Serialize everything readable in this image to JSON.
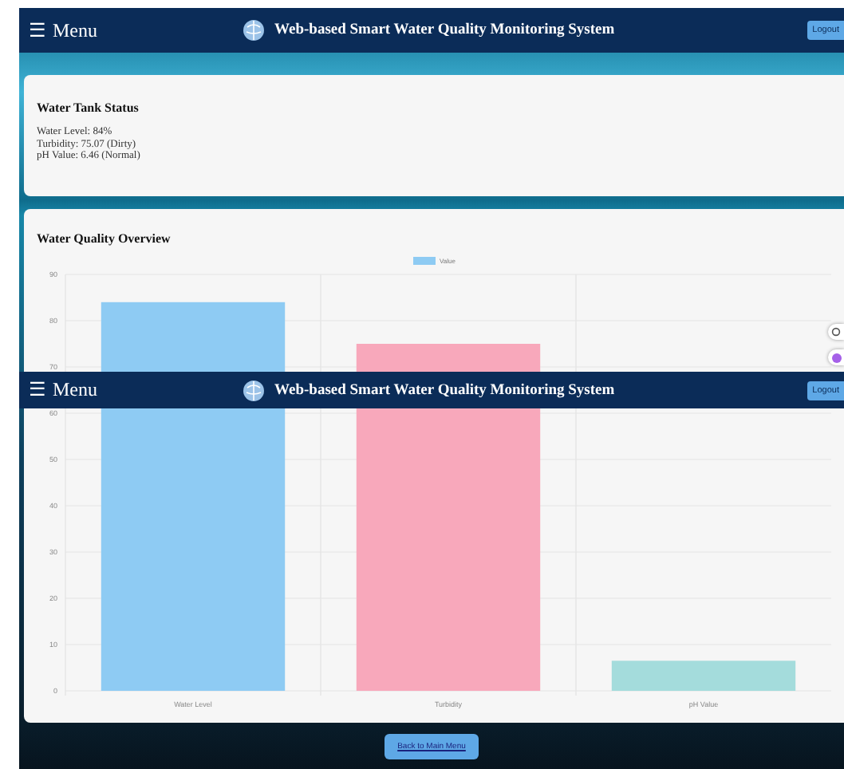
{
  "header": {
    "menu_icon": "☰",
    "menu_label": "Menu",
    "title": "Web-based Smart Water Quality Monitoring System",
    "logout": "Logout"
  },
  "tank_status": {
    "title": "Water Tank Status",
    "lines": [
      "Water Level: 84%",
      "Turbidity: 75.07 (Dirty)",
      "pH Value: 6.46 (Normal)"
    ]
  },
  "overview": {
    "title": "Water Quality Overview",
    "chart_data": {
      "type": "bar",
      "categories": [
        "Water Level",
        "Turbidity",
        "pH Value"
      ],
      "series": [
        {
          "name": "Value",
          "values": [
            84,
            75,
            6.5
          ]
        }
      ],
      "grid": true,
      "ylim": [
        0,
        90
      ],
      "yticks": [
        0,
        10,
        20,
        30,
        40,
        50,
        60,
        70,
        80,
        90
      ]
    }
  },
  "sticky_header": {
    "menu_icon": "☰",
    "menu_label": "Menu",
    "title": "Web-based Smart Water Quality Monitoring System",
    "logout": "Logout"
  },
  "back_button": "Back to Main Menu"
}
